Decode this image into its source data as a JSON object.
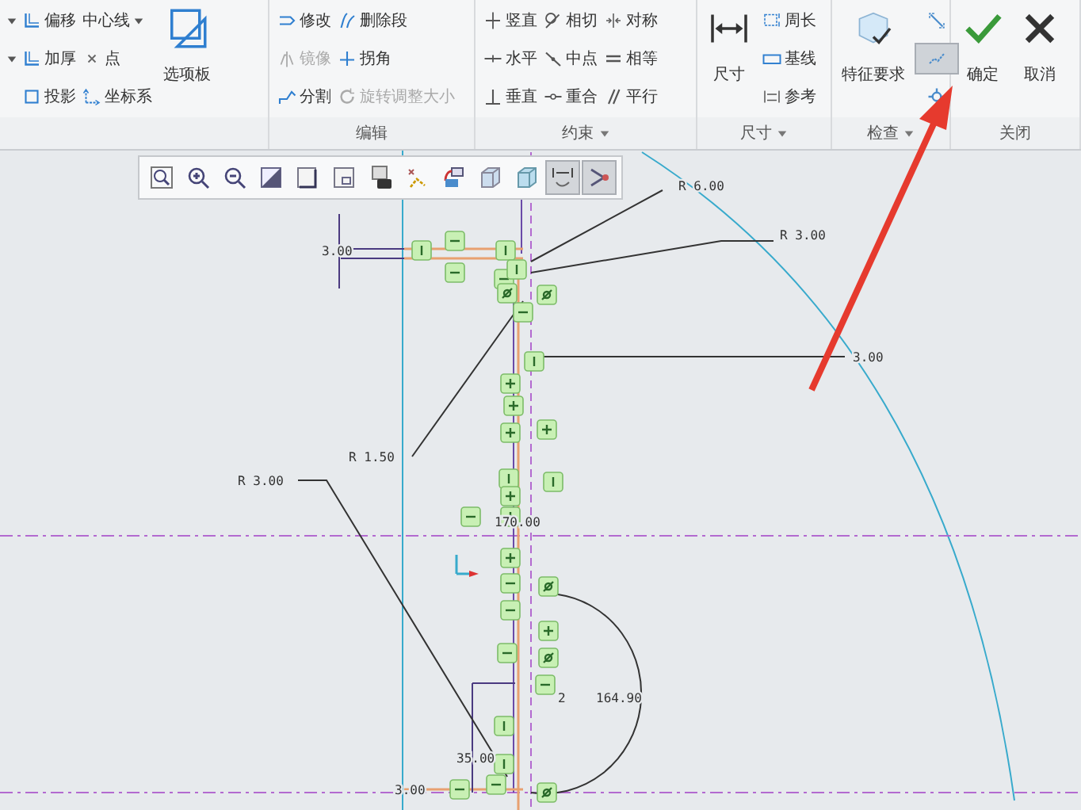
{
  "ribbon": {
    "groups": [
      {
        "parts": [
          {
            "kind": "grid",
            "rows": [
              [
                {
                  "kind": "caret"
                },
                {
                  "kind": "tool",
                  "label": "偏移",
                  "dropdown": false
                },
                {
                  "kind": "tool",
                  "label": "中心线",
                  "dropdown": true
                }
              ],
              [
                {
                  "kind": "caret"
                },
                {
                  "kind": "tool",
                  "label": "加厚",
                  "dropdown": false
                },
                {
                  "kind": "tool",
                  "label": "点",
                  "dropdown": false
                }
              ],
              [
                {
                  "kind": "blank"
                },
                {
                  "kind": "tool",
                  "label": "投影",
                  "dropdown": false
                },
                {
                  "kind": "tool",
                  "label": "坐标系",
                  "dropdown": false
                }
              ]
            ]
          },
          {
            "kind": "large",
            "label": "选项板"
          }
        ]
      },
      {
        "title": "编辑",
        "dropdown": false,
        "parts": [
          {
            "kind": "grid",
            "rows": [
              [
                {
                  "kind": "tool",
                  "label": "修改",
                  "disabled": false
                },
                {
                  "kind": "tool",
                  "label": "删除段",
                  "disabled": false
                }
              ],
              [
                {
                  "kind": "tool",
                  "label": "镜像",
                  "disabled": true
                },
                {
                  "kind": "tool",
                  "label": "拐角",
                  "disabled": false
                }
              ],
              [
                {
                  "kind": "tool",
                  "label": "分割",
                  "disabled": false
                },
                {
                  "kind": "tool",
                  "label": "旋转调整大小",
                  "disabled": true
                }
              ]
            ]
          }
        ]
      },
      {
        "title": "约束",
        "dropdown": true,
        "parts": [
          {
            "kind": "grid",
            "rows": [
              [
                {
                  "kind": "tool",
                  "label": "竖直"
                },
                {
                  "kind": "tool",
                  "label": "相切"
                },
                {
                  "kind": "tool",
                  "label": "对称"
                }
              ],
              [
                {
                  "kind": "tool",
                  "label": "水平"
                },
                {
                  "kind": "tool",
                  "label": "中点"
                },
                {
                  "kind": "tool",
                  "label": "相等"
                }
              ],
              [
                {
                  "kind": "tool",
                  "label": "垂直"
                },
                {
                  "kind": "tool",
                  "label": "重合"
                },
                {
                  "kind": "tool",
                  "label": "平行"
                }
              ]
            ]
          }
        ]
      },
      {
        "title": "尺寸",
        "dropdown": true,
        "parts": [
          {
            "kind": "large",
            "label": "尺寸"
          },
          {
            "kind": "grid",
            "rows": [
              [
                {
                  "kind": "tool",
                  "label": "周长"
                }
              ],
              [
                {
                  "kind": "tool",
                  "label": "基线"
                }
              ],
              [
                {
                  "kind": "tool",
                  "label": "参考"
                }
              ]
            ]
          }
        ]
      },
      {
        "title": "检查",
        "dropdown": true,
        "parts": [
          {
            "kind": "large",
            "label": "特征要求"
          },
          {
            "kind": "grid",
            "rows": [
              [
                {
                  "kind": "icon",
                  "selected": false
                }
              ],
              [
                {
                  "kind": "icon",
                  "selected": true
                }
              ],
              [
                {
                  "kind": "icon",
                  "selected": false
                }
              ]
            ]
          }
        ]
      },
      {
        "title": "关闭",
        "dropdown": false,
        "parts": [
          {
            "kind": "large",
            "label": "确定"
          },
          {
            "kind": "large",
            "label": "取消"
          }
        ]
      }
    ]
  },
  "view_toolbar": {
    "buttons": [
      {
        "selected": false
      },
      {
        "selected": false
      },
      {
        "selected": false
      },
      {
        "selected": false
      },
      {
        "selected": false
      },
      {
        "selected": false
      },
      {
        "selected": false
      },
      {
        "selected": false
      },
      {
        "selected": false
      },
      {
        "selected": false
      },
      {
        "selected": false
      },
      {
        "selected": true
      },
      {
        "selected": true
      }
    ]
  },
  "sketch": {
    "dimension_labels": [
      "R 6.00",
      "R 3.00",
      "3.00",
      "3.00",
      "R 1.50",
      "R 3.00",
      "170.00",
      "2",
      "164.90",
      "35.00",
      "3.00"
    ]
  }
}
